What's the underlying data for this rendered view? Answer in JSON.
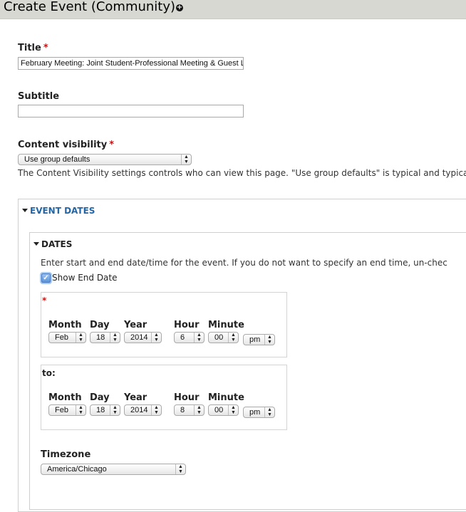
{
  "header": {
    "title": "Create Event (Community)",
    "add_icon": "circle-plus-icon"
  },
  "form": {
    "title_field": {
      "label": "Title",
      "required_mark": "*",
      "value": "February Meeting: Joint Student-Professional Meeting & Guest L"
    },
    "subtitle_field": {
      "label": "Subtitle",
      "value": ""
    },
    "visibility_field": {
      "label": "Content visibility",
      "required_mark": "*",
      "selected": "Use group defaults",
      "help": "The Content Visibility settings controls who can view this page. \"Use group defaults\" is typical and typically c"
    },
    "event_dates": {
      "legend": "EVENT DATES",
      "dates": {
        "legend": "DATES",
        "help": "Enter start and end date/time for the event. If you do not want to specify an end time, un-chec",
        "show_end_date": {
          "label": "Show End Date",
          "checked": true
        },
        "columns": {
          "month": "Month",
          "day": "Day",
          "year": "Year",
          "hour": "Hour",
          "minute": "Minute"
        },
        "start": {
          "required_mark": "*",
          "month": "Feb",
          "day": "18",
          "year": "2014",
          "hour": "6",
          "minute": "00",
          "ampm": "pm"
        },
        "end": {
          "label": "to:",
          "month": "Feb",
          "day": "18",
          "year": "2014",
          "hour": "8",
          "minute": "00",
          "ampm": "pm"
        }
      },
      "timezone": {
        "label": "Timezone",
        "selected": "America/Chicago"
      }
    }
  }
}
